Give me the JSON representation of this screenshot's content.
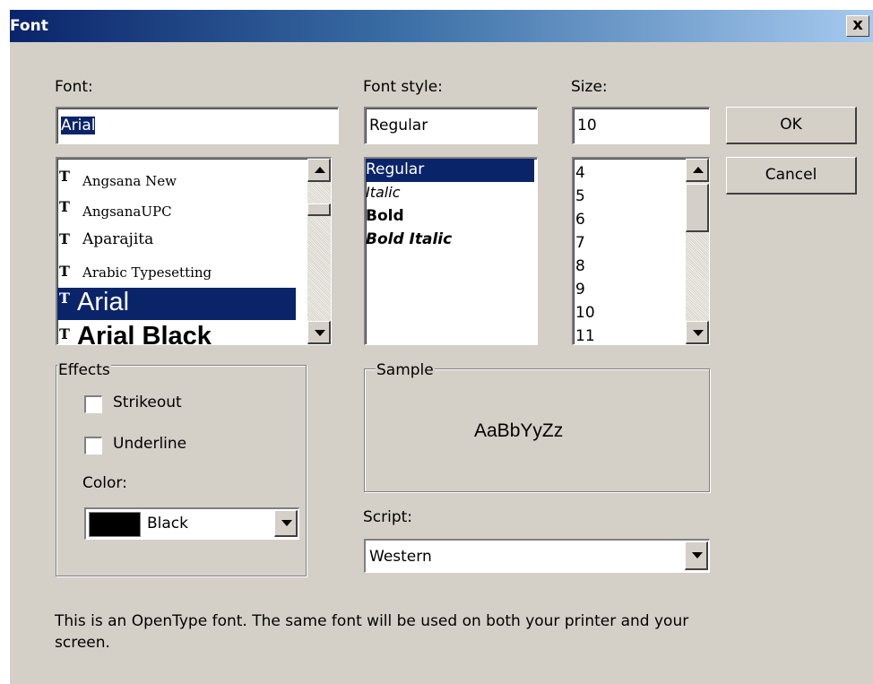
{
  "window": {
    "title": "Font",
    "close_glyph": "x"
  },
  "labels": {
    "font": "Font:",
    "font_style": "Font style:",
    "size": "Size:",
    "effects": "Effects",
    "sample": "Sample",
    "color": "Color:",
    "script": "Script:"
  },
  "font": {
    "value": "Arial",
    "list": [
      "Angsana New",
      "AngsanaUPC",
      "Aparajita",
      "Arabic Typesetting",
      "Arial",
      "Arial Black"
    ],
    "selected": "Arial",
    "icon": "truetype-icon"
  },
  "font_style": {
    "value": "Regular",
    "list": [
      "Regular",
      "Italic",
      "Bold",
      "Bold Italic"
    ],
    "selected": "Regular"
  },
  "size": {
    "value": "10",
    "list": [
      "4",
      "5",
      "6",
      "7",
      "8",
      "9",
      "10",
      "11"
    ]
  },
  "effects": {
    "strikeout": {
      "label": "Strikeout",
      "checked": false
    },
    "underline": {
      "label": "Underline",
      "checked": false
    },
    "color": {
      "value": "Black",
      "swatch": "#000000"
    }
  },
  "sample_text": "AaBbYyZz",
  "script": {
    "value": "Western"
  },
  "buttons": {
    "ok": "OK",
    "cancel": "Cancel"
  },
  "description": "This is an OpenType font. The same font will be used on both your printer and your screen.",
  "colors": {
    "selection": "#0a246a",
    "face": "#d4d0c8",
    "title_start": "#0a246a",
    "title_end": "#a6caf0"
  }
}
